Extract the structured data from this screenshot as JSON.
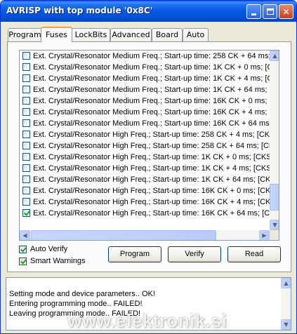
{
  "window": {
    "title": "AVRISP with top module '0x8C'"
  },
  "tabs": [
    {
      "label": "Program",
      "active": false
    },
    {
      "label": "Fuses",
      "active": true
    },
    {
      "label": "LockBits",
      "active": false
    },
    {
      "label": "Advanced",
      "active": false
    },
    {
      "label": "Board",
      "active": false
    },
    {
      "label": "Auto",
      "active": false
    }
  ],
  "fuses": [
    {
      "label": "Ext. Crystal/Resonator Medium Freq.; Start-up time: 258 CK + 64 ms; [CK",
      "checked": false
    },
    {
      "label": "Ext. Crystal/Resonator Medium Freq.; Start-up time: 1K CK + 0 ms; [CKS",
      "checked": false
    },
    {
      "label": "Ext. Crystal/Resonator Medium Freq.; Start-up time: 1K CK + 4 ms; [CKS",
      "checked": false
    },
    {
      "label": "Ext. Crystal/Resonator Medium Freq.; Start-up time: 1K CK + 64 ms; [CK",
      "checked": false
    },
    {
      "label": "Ext. Crystal/Resonator Medium Freq.; Start-up time: 16K CK + 0 ms; [CK",
      "checked": false
    },
    {
      "label": "Ext. Crystal/Resonator Medium Freq.; Start-up time: 16K CK + 4 ms; [CK",
      "checked": false
    },
    {
      "label": "Ext. Crystal/Resonator Medium Freq.; Start-up time: 16K CK + 64 ms; [C",
      "checked": false
    },
    {
      "label": "Ext. Crystal/Resonator High Freq.; Start-up time: 258 CK + 4 ms; [CKSE",
      "checked": false
    },
    {
      "label": "Ext. Crystal/Resonator High Freq.; Start-up time: 258 CK + 64 ms; [CKS",
      "checked": false
    },
    {
      "label": "Ext. Crystal/Resonator High Freq.; Start-up time: 1K CK + 0 ms; [CKSEL",
      "checked": false
    },
    {
      "label": "Ext. Crystal/Resonator High Freq.; Start-up time: 1K CK + 4 ms; [CKSEL",
      "checked": false
    },
    {
      "label": "Ext. Crystal/Resonator High Freq.; Start-up time: 1K CK + 64 ms; [CKSE",
      "checked": false
    },
    {
      "label": "Ext. Crystal/Resonator High Freq.; Start-up time: 16K CK + 0 ms; [CKSE",
      "checked": false
    },
    {
      "label": "Ext. Crystal/Resonator High Freq.; Start-up time: 16K CK + 4 ms; [CKSE",
      "checked": false
    },
    {
      "label": "Ext. Crystal/Resonator High Freq.; Start-up time: 16K CK + 64 ms; [CKS",
      "checked": true
    }
  ],
  "options": {
    "auto_verify": {
      "label": "Auto Verify",
      "checked": true
    },
    "smart_warnings": {
      "label": "Smart Warnings",
      "checked": true
    }
  },
  "buttons": {
    "program": "Program",
    "verify": "Verify",
    "read": "Read"
  },
  "log": [
    "Setting mode and device parameters.. OK!",
    "Entering programming mode.. FAILED!",
    "Leaving programming mode.. FAILED!"
  ],
  "watermark": "www.elektronik.si"
}
